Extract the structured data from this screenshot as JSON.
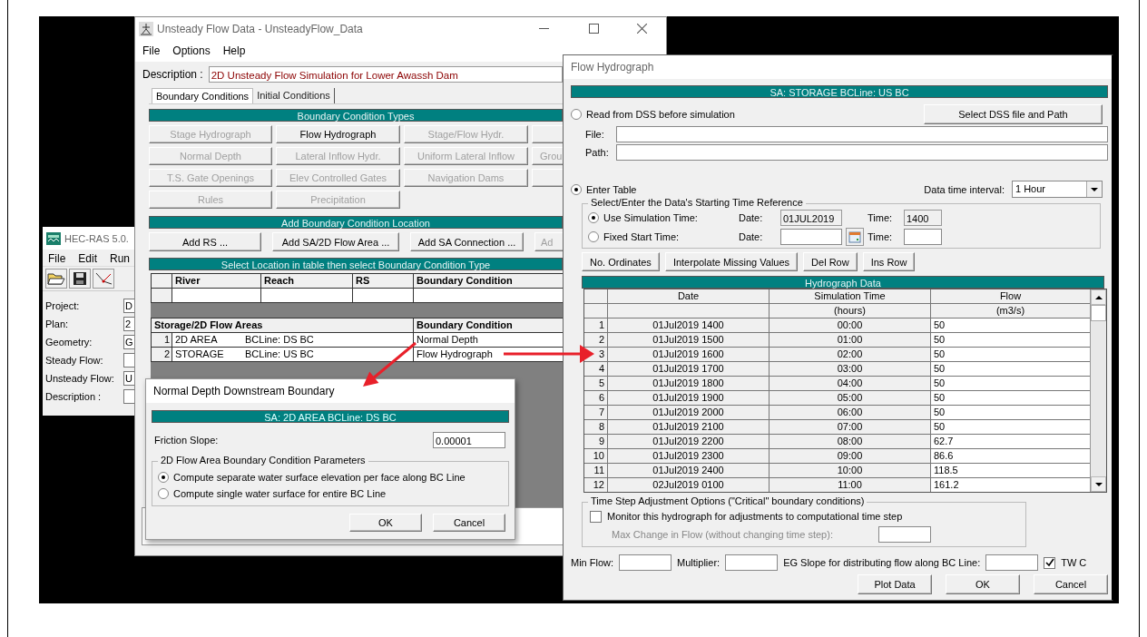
{
  "hecras_window": {
    "title": "HEC-RAS 5.0.",
    "menu": [
      "File",
      "Edit",
      "Run"
    ],
    "fields": [
      {
        "label": "Project:",
        "value": "D"
      },
      {
        "label": "Plan:",
        "value": "2"
      },
      {
        "label": "Geometry:",
        "value": "G"
      },
      {
        "label": "Steady Flow:"
      },
      {
        "label": "Unsteady Flow:",
        "value": "U"
      },
      {
        "label": "Description :"
      }
    ]
  },
  "unsteady_window": {
    "title": "Unsteady Flow Data - UnsteadyFlow_Data",
    "menu": [
      "File",
      "Options",
      "Help"
    ],
    "description_label": "Description :",
    "description": "2D Unsteady Flow Simulation for Lower Awassh Dam",
    "tabs": [
      {
        "label": "Boundary Conditions",
        "selected": true
      },
      {
        "label": "Initial Conditions",
        "selected": false
      }
    ],
    "bc_types_title": "Boundary Condition Types",
    "bc_types": [
      {
        "kind": "button",
        "label": "Stage Hydrograph",
        "disabled": true
      },
      {
        "kind": "button",
        "label": "Flow Hydrograph",
        "disabled": false
      },
      {
        "kind": "button",
        "label": "Stage/Flow Hydr.",
        "disabled": true
      },
      {
        "kind": "blank"
      },
      {
        "kind": "button",
        "label": "Normal Depth",
        "disabled": true
      },
      {
        "kind": "button",
        "label": "Lateral Inflow Hydr.",
        "disabled": true
      },
      {
        "kind": "button",
        "label": "Uniform Lateral Inflow",
        "disabled": true
      },
      {
        "kind": "button",
        "label": "Grou",
        "disabled": true
      },
      {
        "kind": "button",
        "label": "T.S. Gate Openings",
        "disabled": true
      },
      {
        "kind": "button",
        "label": "Elev Controlled Gates",
        "disabled": true
      },
      {
        "kind": "button",
        "label": "Navigation Dams",
        "disabled": true
      },
      {
        "kind": "blank"
      },
      {
        "kind": "button",
        "label": "Rules",
        "disabled": true
      },
      {
        "kind": "button",
        "label": "Precipitation",
        "disabled": true
      }
    ],
    "add_location_title": "Add Boundary Condition Location",
    "add_buttons": [
      {
        "label": "Add RS ...",
        "disabled": false
      },
      {
        "label": "Add SA/2D Flow Area ...",
        "disabled": false
      },
      {
        "label": "Add SA Connection ...",
        "disabled": false
      },
      {
        "label": "Ad",
        "disabled": true
      }
    ],
    "location_table_title": "Select Location in table then select Boundary Condition Type",
    "river_columns": [
      "River",
      "Reach",
      "RS",
      "Boundary Condition"
    ],
    "storage_columns": [
      "Storage/2D Flow Areas",
      "Boundary Condition"
    ],
    "storage_rows": [
      {
        "number": "1",
        "area": "2D AREA",
        "bc_line": "BCLine: DS BC",
        "boundary_condition": "Normal Depth"
      },
      {
        "number": "2",
        "area": "STORAGE",
        "bc_line": "BCLine: US BC",
        "boundary_condition": "Flow Hydrograph"
      }
    ]
  },
  "normal_depth_dialog": {
    "title": "Normal Depth Downstream Boundary",
    "header": "SA: 2D AREA BCLine: DS BC",
    "friction_label": "Friction Slope:",
    "friction_value": "0.00001",
    "group_title": "2D Flow Area Boundary Condition Parameters",
    "options": [
      {
        "label": "Compute separate water surface elevation per face along BC Line",
        "selected": true
      },
      {
        "label": "Compute single water surface for entire BC Line",
        "selected": false
      }
    ],
    "buttons": [
      "OK",
      "Cancel"
    ]
  },
  "flow_hydrograph_window": {
    "title": "Flow Hydrograph",
    "header": "SA: STORAGE BCLine: US BC",
    "dss_option": {
      "label": "Read from DSS before simulation",
      "selected": false
    },
    "dss_button": "Select DSS file and Path",
    "file_label": "File:",
    "path_label": "Path:",
    "table_option": {
      "label": "Enter Table",
      "selected": true
    },
    "interval_label": "Data time interval:",
    "interval_value": "1 Hour",
    "time_group_title": "Select/Enter the Data's Starting Time Reference",
    "time_options": [
      {
        "label": "Use Simulation Time:",
        "selected": true,
        "date_label": "Date:",
        "date": "01JUL2019",
        "time_label": "Time:",
        "time": "1400",
        "calendar": false
      },
      {
        "label": "Fixed Start Time:",
        "selected": false,
        "date_label": "Date:",
        "time_label": "Time:",
        "calendar": true
      }
    ],
    "table_buttons": [
      "No. Ordinates",
      "Interpolate Missing Values",
      "Del Row",
      "Ins Row"
    ],
    "table_title": "Hydrograph Data",
    "columns": [
      "Date",
      "Simulation Time",
      "Flow"
    ],
    "units": [
      "(hours)",
      "(m3/s)"
    ],
    "rows": [
      {
        "number": "1",
        "date": "01Jul2019 1400",
        "time": "00:00",
        "flow": "50"
      },
      {
        "number": "2",
        "date": "01Jul2019 1500",
        "time": "01:00",
        "flow": "50"
      },
      {
        "number": "3",
        "date": "01Jul2019 1600",
        "time": "02:00",
        "flow": "50"
      },
      {
        "number": "4",
        "date": "01Jul2019 1700",
        "time": "03:00",
        "flow": "50"
      },
      {
        "number": "5",
        "date": "01Jul2019 1800",
        "time": "04:00",
        "flow": "50"
      },
      {
        "number": "6",
        "date": "01Jul2019 1900",
        "time": "05:00",
        "flow": "50"
      },
      {
        "number": "7",
        "date": "01Jul2019 2000",
        "time": "06:00",
        "flow": "50"
      },
      {
        "number": "8",
        "date": "01Jul2019 2100",
        "time": "07:00",
        "flow": "50"
      },
      {
        "number": "9",
        "date": "01Jul2019 2200",
        "time": "08:00",
        "flow": "62.7"
      },
      {
        "number": "10",
        "date": "01Jul2019 2300",
        "time": "09:00",
        "flow": "86.6"
      },
      {
        "number": "11",
        "date": "01Jul2019 2400",
        "time": "10:00",
        "flow": "118.5"
      },
      {
        "number": "12",
        "date": "02Jul2019 0100",
        "time": "11:00",
        "flow": "161.2"
      }
    ],
    "timestep_group_title": "Time Step Adjustment Options (\"Critical\" boundary conditions)",
    "monitor": {
      "label": "Monitor this hydrograph for adjustments to computational time step",
      "checked": false
    },
    "max_change_label": "Max Change in Flow (without changing time step):",
    "min_flow_label": "Min Flow:",
    "multiplier_label": "Multiplier:",
    "eg_slope_label": "EG Slope for distributing flow along BC Line:",
    "tw": {
      "label": "TW C",
      "checked": true
    },
    "buttons": [
      "Plot Data",
      "OK",
      "Cancel"
    ]
  }
}
